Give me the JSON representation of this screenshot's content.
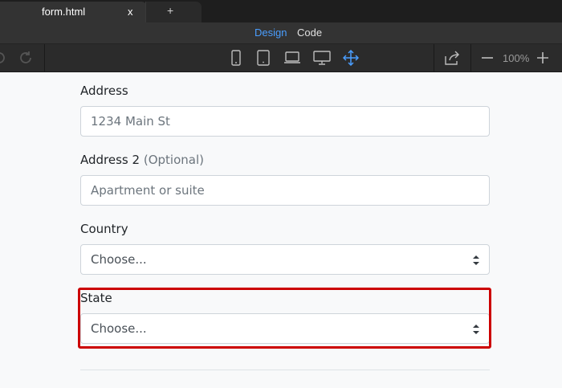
{
  "tabs": {
    "active_title": "form.html",
    "close_label": "x",
    "new_tab_label": "+"
  },
  "modes": {
    "design": "Design",
    "code": "Code"
  },
  "toolbar": {
    "zoom_level": "100%",
    "device_icons": [
      "phone-icon",
      "tablet-icon",
      "laptop-icon",
      "desktop-icon",
      "responsive-move-icon"
    ]
  },
  "form": {
    "address_label": "Address",
    "address_placeholder": "1234 Main St",
    "address2_label": "Address 2",
    "address2_optional": "(Optional)",
    "address2_placeholder": "Apartment or suite",
    "country_label": "Country",
    "country_value": "Choose...",
    "state_label": "State",
    "state_value": "Choose..."
  },
  "colors": {
    "accent": "#4a9eff",
    "highlight": "#cc0000"
  }
}
